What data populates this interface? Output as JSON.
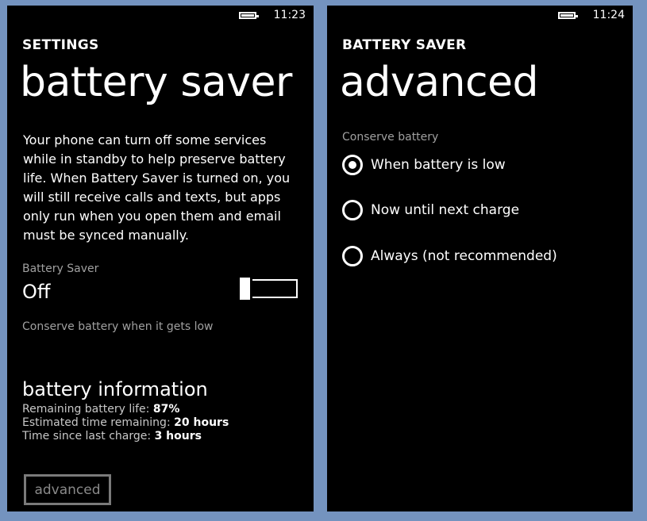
{
  "left": {
    "status": {
      "time": "11:23",
      "battery_icon": "battery-full-icon"
    },
    "overline": "SETTINGS",
    "title": "battery saver",
    "description": "Your phone can turn off some services while in standby to help preserve battery life. When Battery Saver is turned on, you will still receive calls and texts, but apps only run when you open them and email must be synced manually.",
    "battery_saver_label": "Battery Saver",
    "battery_saver_value": "Off",
    "conserve_link": "Conserve battery when it gets low",
    "info": {
      "heading": "battery information",
      "remaining_label": "Remaining battery life:",
      "remaining_value": "87%",
      "estimated_label": "Estimated time remaining:",
      "estimated_value": "20 hours",
      "since_label": "Time since last charge:",
      "since_value": "3 hours"
    },
    "advanced_button": "advanced"
  },
  "right": {
    "status": {
      "time": "11:24",
      "battery_icon": "battery-full-icon"
    },
    "overline": "BATTERY SAVER",
    "title": "advanced",
    "conserve_label": "Conserve battery",
    "options": [
      {
        "label": "When battery is low",
        "selected": true
      },
      {
        "label": "Now until next charge",
        "selected": false
      },
      {
        "label": "Always (not recommended)",
        "selected": false
      }
    ]
  },
  "colors": {
    "background": "#7493bf",
    "screen": "#000000",
    "text": "#ffffff",
    "muted": "#a0a0a0"
  }
}
